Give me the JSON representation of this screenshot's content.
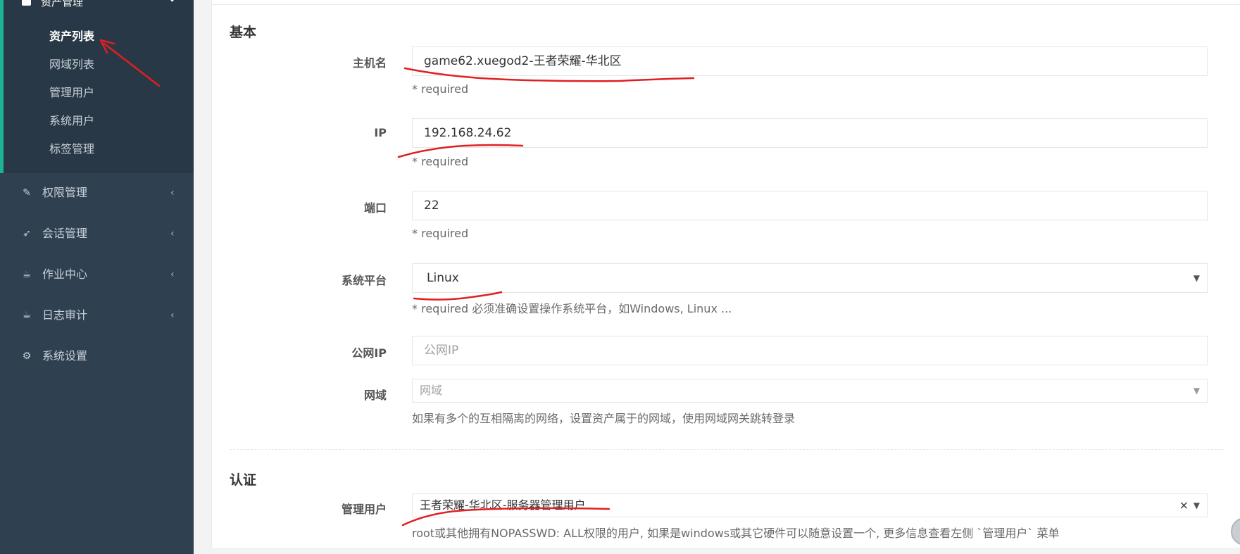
{
  "sidebar": {
    "asset_group": {
      "label": "资产管理",
      "items": [
        "资产列表",
        "网域列表",
        "管理用户",
        "系统用户",
        "标签管理"
      ]
    },
    "nav": [
      {
        "label": "权限管理",
        "icon": "edit-icon"
      },
      {
        "label": "会话管理",
        "icon": "rocket-icon"
      },
      {
        "label": "作业中心",
        "icon": "coffee-icon"
      },
      {
        "label": "日志审计",
        "icon": "coffee-icon"
      },
      {
        "label": "系统设置",
        "icon": "cogs-icon"
      }
    ]
  },
  "form": {
    "basic_title": "基本",
    "hostname": {
      "label": "主机名",
      "value": "game62.xuegod2-王者荣耀-华北区",
      "help": "* required"
    },
    "ip": {
      "label": "IP",
      "value": "192.168.24.62",
      "help": "* required"
    },
    "port": {
      "label": "端口",
      "value": "22",
      "help": "* required"
    },
    "platform": {
      "label": "系统平台",
      "value": "Linux",
      "help": "* required 必须准确设置操作系统平台，如Windows, Linux ..."
    },
    "public_ip": {
      "label": "公网IP",
      "placeholder": "公网IP"
    },
    "domain": {
      "label": "网域",
      "placeholder": "网域",
      "help": "如果有多个的互相隔离的网络，设置资产属于的网域，使用网域网关跳转登录"
    },
    "auth_title": "认证",
    "admin_user": {
      "label": "管理用户",
      "value": "王者荣耀-华北区-服务器管理用户",
      "clear": "×",
      "help": "root或其他拥有NOPASSWD: ALL权限的用户, 如果是windows或其它硬件可以随意设置一个, 更多信息查看左侧 `管理用户` 菜单"
    }
  },
  "glyphs": {
    "dropdown": "▼",
    "nav_arrow": "‹"
  },
  "colors": {
    "sidebar": "#2f4050",
    "active_bar": "#1ab394",
    "annotation": "#e02020"
  }
}
